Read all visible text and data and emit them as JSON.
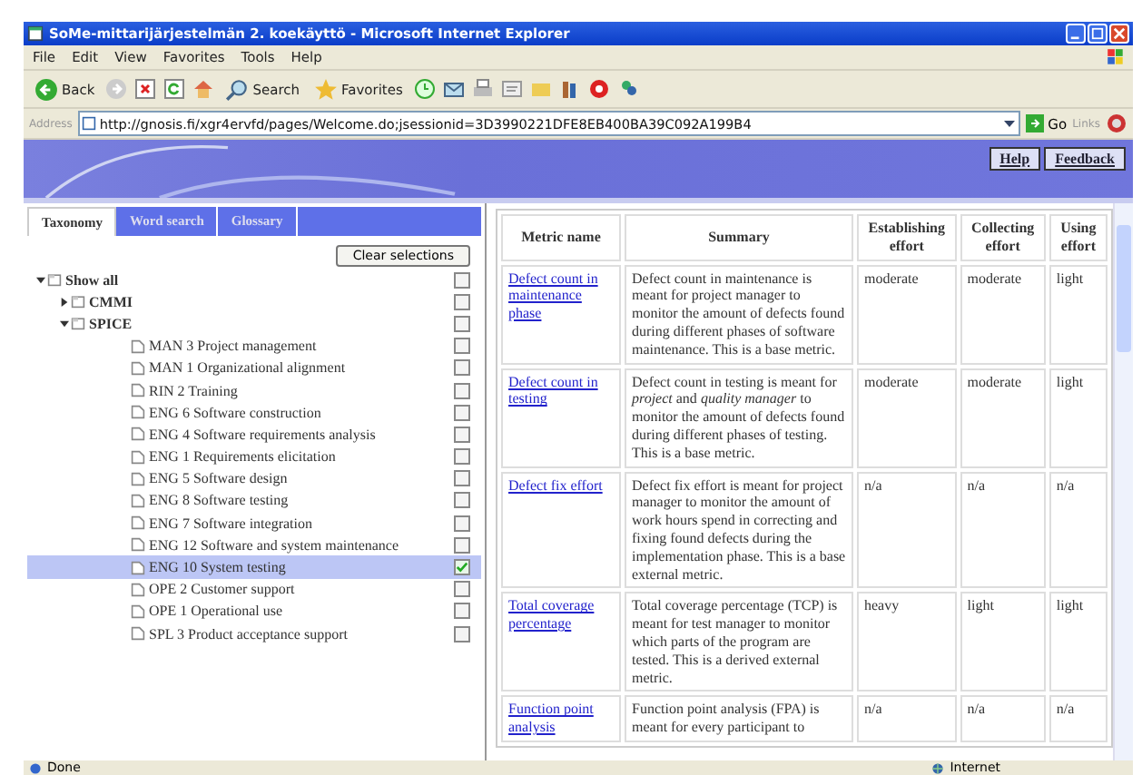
{
  "window": {
    "title": "SoMe-mittarijärjestelmän 2. koekäyttö - Microsoft Internet Explorer"
  },
  "menu": [
    "File",
    "Edit",
    "View",
    "Favorites",
    "Tools",
    "Help"
  ],
  "toolbar": {
    "back": "Back",
    "search": "Search",
    "favorites": "Favorites"
  },
  "address": {
    "label": "Address",
    "url": "http://gnosis.fi/xgr4ervfd/pages/Welcome.do;jsessionid=3D3990221DFE8EB400BA39C092A199B4",
    "go": "Go",
    "links": "Links"
  },
  "header_links": [
    "Help",
    "Feedback"
  ],
  "tabs": [
    {
      "label": "Taxonomy",
      "selected": true
    },
    {
      "label": "Word search",
      "selected": false
    },
    {
      "label": "Glossary",
      "selected": false
    }
  ],
  "clear_button": "Clear selections",
  "tree": [
    {
      "label": "Show all",
      "expanded": true,
      "checked": false,
      "selected": false,
      "children": [
        {
          "label": "CMMI",
          "expanded": false,
          "checked": false,
          "selected": false
        },
        {
          "label": "SPICE",
          "expanded": true,
          "checked": false,
          "selected": false,
          "children": [
            {
              "label": "MAN 3 Project management",
              "checked": false,
              "selected": false
            },
            {
              "label": "MAN 1 Organizational alignment",
              "checked": false,
              "selected": false
            },
            {
              "label": "RIN 2 Training",
              "checked": false,
              "selected": false
            },
            {
              "label": "ENG 6 Software construction",
              "checked": false,
              "selected": false
            },
            {
              "label": "ENG 4 Software requirements analysis",
              "checked": false,
              "selected": false
            },
            {
              "label": "ENG 1 Requirements elicitation",
              "checked": false,
              "selected": false
            },
            {
              "label": "ENG 5 Software design",
              "checked": false,
              "selected": false
            },
            {
              "label": "ENG 8 Software testing",
              "checked": false,
              "selected": false
            },
            {
              "label": "ENG 7 Software integration",
              "checked": false,
              "selected": false
            },
            {
              "label": "ENG 12 Software and system maintenance",
              "checked": false,
              "selected": false
            },
            {
              "label": "ENG 10 System testing",
              "checked": true,
              "selected": true
            },
            {
              "label": "OPE 2 Customer support",
              "checked": false,
              "selected": false
            },
            {
              "label": "OPE 1 Operational use",
              "checked": false,
              "selected": false
            },
            {
              "label": "SPL 3 Product acceptance support",
              "checked": false,
              "selected": false
            }
          ]
        }
      ]
    }
  ],
  "table": {
    "columns": [
      "Metric name",
      "Summary",
      "Establishing effort",
      "Collecting effort",
      "Using effort"
    ],
    "rows": [
      {
        "name": "Defect count in maintenance phase",
        "summary": "Defect count in maintenance is meant for project manager to monitor the amount of defects found during different phases of software maintenance. This is a base metric.",
        "establishing": "moderate",
        "collecting": "moderate",
        "using": "light"
      },
      {
        "name": "Defect count in testing",
        "summary": "Defect count in testing is meant for *project* and *quality manager* to monitor the amount of defects found during different phases of testing. This is a base metric.",
        "establishing": "moderate",
        "collecting": "moderate",
        "using": "light"
      },
      {
        "name": "Defect fix effort",
        "summary": "Defect fix effort  is meant for project manager to monitor the amount of work hours spend in correcting and fixing found defects during the implementation phase. This is a base external metric.",
        "establishing": "n/a",
        "collecting": "n/a",
        "using": "n/a"
      },
      {
        "name": "Total coverage percentage",
        "summary": "Total coverage percentage (TCP) is meant for test manager to monitor which parts of the program are tested. This is a derived external metric.",
        "establishing": "heavy",
        "collecting": "light",
        "using": "light"
      },
      {
        "name": "Function point analysis",
        "summary": "Function point analysis (FPA) is meant for every participant to",
        "establishing": "n/a",
        "collecting": "n/a",
        "using": "n/a"
      }
    ]
  },
  "status_bar": {
    "text": "Done",
    "zone": "Internet"
  }
}
